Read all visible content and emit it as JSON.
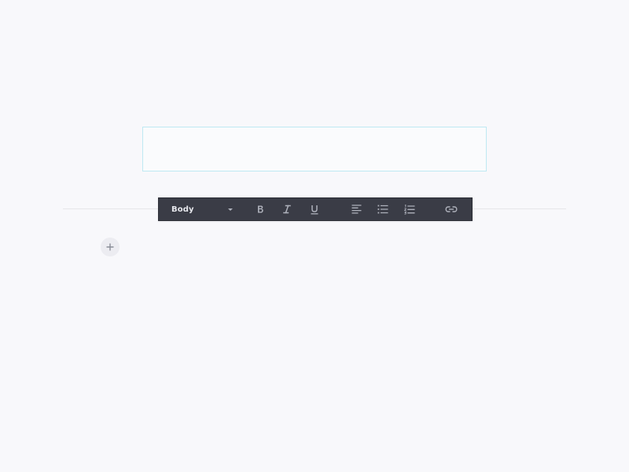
{
  "editor": {
    "text_block_value": ""
  },
  "toolbar": {
    "style_select": {
      "selected": "Body"
    },
    "buttons": [
      {
        "icon": "bold-icon"
      },
      {
        "icon": "italic-icon"
      },
      {
        "icon": "underline-icon"
      },
      {
        "icon": "align-left-icon"
      },
      {
        "icon": "bullet-list-icon"
      },
      {
        "icon": "numbered-list-icon"
      },
      {
        "icon": "link-icon"
      }
    ]
  },
  "add_block": {
    "icon": "plus-icon"
  },
  "colors": {
    "background": "#f8f8fb",
    "toolbar_bg": "#3a3c46",
    "toolbar_icon": "#aeb1bb",
    "focus_border": "#bfe9f3",
    "divider": "#e6e6ea"
  }
}
